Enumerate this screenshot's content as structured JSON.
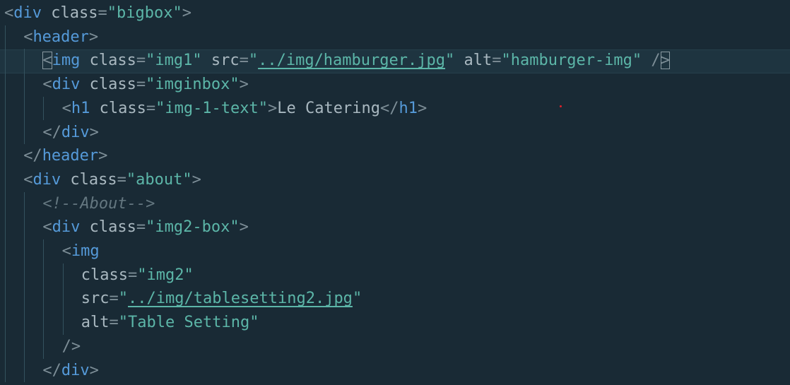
{
  "editor": {
    "language": "html",
    "colors": {
      "background": "#192a35",
      "tag": "#559ad9",
      "attribute": "#a9b8c0",
      "string": "#5cb6a8",
      "comment": "#647780",
      "punctuation": "#7d8e97"
    },
    "lines": [
      {
        "indent": 0,
        "tokens": [
          {
            "t": "pun",
            "v": "<"
          },
          {
            "t": "tag",
            "v": "div"
          },
          {
            "t": "attr",
            "v": " class"
          },
          {
            "t": "pun",
            "v": "="
          },
          {
            "t": "str",
            "v": "\"bigbox\""
          },
          {
            "t": "pun",
            "v": ">"
          }
        ]
      },
      {
        "indent": 1,
        "tokens": [
          {
            "t": "pun",
            "v": "<"
          },
          {
            "t": "tag",
            "v": "header"
          },
          {
            "t": "pun",
            "v": ">"
          }
        ]
      },
      {
        "indent": 2,
        "highlight": true,
        "tokens": [
          {
            "t": "pun",
            "v": "<",
            "match": true
          },
          {
            "t": "tag",
            "v": "img"
          },
          {
            "t": "attr",
            "v": " class"
          },
          {
            "t": "pun",
            "v": "="
          },
          {
            "t": "str",
            "v": "\"img1\""
          },
          {
            "t": "attr",
            "v": " src"
          },
          {
            "t": "pun",
            "v": "="
          },
          {
            "t": "str",
            "v": "\""
          },
          {
            "t": "str",
            "v": "../img/hamburger.jpg",
            "link": true
          },
          {
            "t": "str",
            "v": "\""
          },
          {
            "t": "attr",
            "v": " alt"
          },
          {
            "t": "pun",
            "v": "="
          },
          {
            "t": "str",
            "v": "\"hamburger-img\""
          },
          {
            "t": "pun",
            "v": " /"
          },
          {
            "t": "pun",
            "v": ">",
            "match": true
          }
        ]
      },
      {
        "indent": 2,
        "tokens": [
          {
            "t": "pun",
            "v": "<"
          },
          {
            "t": "tag",
            "v": "div"
          },
          {
            "t": "attr",
            "v": " class"
          },
          {
            "t": "pun",
            "v": "="
          },
          {
            "t": "str",
            "v": "\"imginbox\""
          },
          {
            "t": "pun",
            "v": ">"
          }
        ]
      },
      {
        "indent": 3,
        "tokens": [
          {
            "t": "pun",
            "v": "<"
          },
          {
            "t": "tag",
            "v": "h1"
          },
          {
            "t": "attr",
            "v": " class"
          },
          {
            "t": "pun",
            "v": "="
          },
          {
            "t": "str",
            "v": "\"img-1-text\""
          },
          {
            "t": "pun",
            "v": ">"
          },
          {
            "t": "txt",
            "v": "Le Catering"
          },
          {
            "t": "pun",
            "v": "</"
          },
          {
            "t": "tag",
            "v": "h1"
          },
          {
            "t": "pun",
            "v": ">"
          }
        ]
      },
      {
        "indent": 2,
        "tokens": [
          {
            "t": "pun",
            "v": "</"
          },
          {
            "t": "tag",
            "v": "div"
          },
          {
            "t": "pun",
            "v": ">"
          }
        ]
      },
      {
        "indent": 1,
        "tokens": [
          {
            "t": "pun",
            "v": "</"
          },
          {
            "t": "tag",
            "v": "header"
          },
          {
            "t": "pun",
            "v": ">"
          }
        ]
      },
      {
        "indent": 1,
        "tokens": [
          {
            "t": "pun",
            "v": "<"
          },
          {
            "t": "tag",
            "v": "div"
          },
          {
            "t": "attr",
            "v": " class"
          },
          {
            "t": "pun",
            "v": "="
          },
          {
            "t": "str",
            "v": "\"about\""
          },
          {
            "t": "pun",
            "v": ">"
          }
        ]
      },
      {
        "indent": 2,
        "tokens": [
          {
            "t": "cmt",
            "v": "<!--About-->"
          }
        ]
      },
      {
        "indent": 2,
        "tokens": [
          {
            "t": "pun",
            "v": "<"
          },
          {
            "t": "tag",
            "v": "div"
          },
          {
            "t": "attr",
            "v": " class"
          },
          {
            "t": "pun",
            "v": "="
          },
          {
            "t": "str",
            "v": "\"img2-box\""
          },
          {
            "t": "pun",
            "v": ">"
          }
        ]
      },
      {
        "indent": 3,
        "tokens": [
          {
            "t": "pun",
            "v": "<"
          },
          {
            "t": "tag",
            "v": "img"
          }
        ]
      },
      {
        "indent": 4,
        "tokens": [
          {
            "t": "attr",
            "v": "class"
          },
          {
            "t": "pun",
            "v": "="
          },
          {
            "t": "str",
            "v": "\"img2\""
          }
        ]
      },
      {
        "indent": 4,
        "tokens": [
          {
            "t": "attr",
            "v": "src"
          },
          {
            "t": "pun",
            "v": "="
          },
          {
            "t": "str",
            "v": "\""
          },
          {
            "t": "str",
            "v": "../img/tablesetting2.jpg",
            "link": true
          },
          {
            "t": "str",
            "v": "\""
          }
        ]
      },
      {
        "indent": 4,
        "tokens": [
          {
            "t": "attr",
            "v": "alt"
          },
          {
            "t": "pun",
            "v": "="
          },
          {
            "t": "str",
            "v": "\"Table Setting\""
          }
        ]
      },
      {
        "indent": 3,
        "tokens": [
          {
            "t": "pun",
            "v": "/>"
          }
        ]
      },
      {
        "indent": 2,
        "tokens": [
          {
            "t": "pun",
            "v": "</"
          },
          {
            "t": "tag",
            "v": "div"
          },
          {
            "t": "pun",
            "v": ">"
          }
        ]
      }
    ]
  }
}
